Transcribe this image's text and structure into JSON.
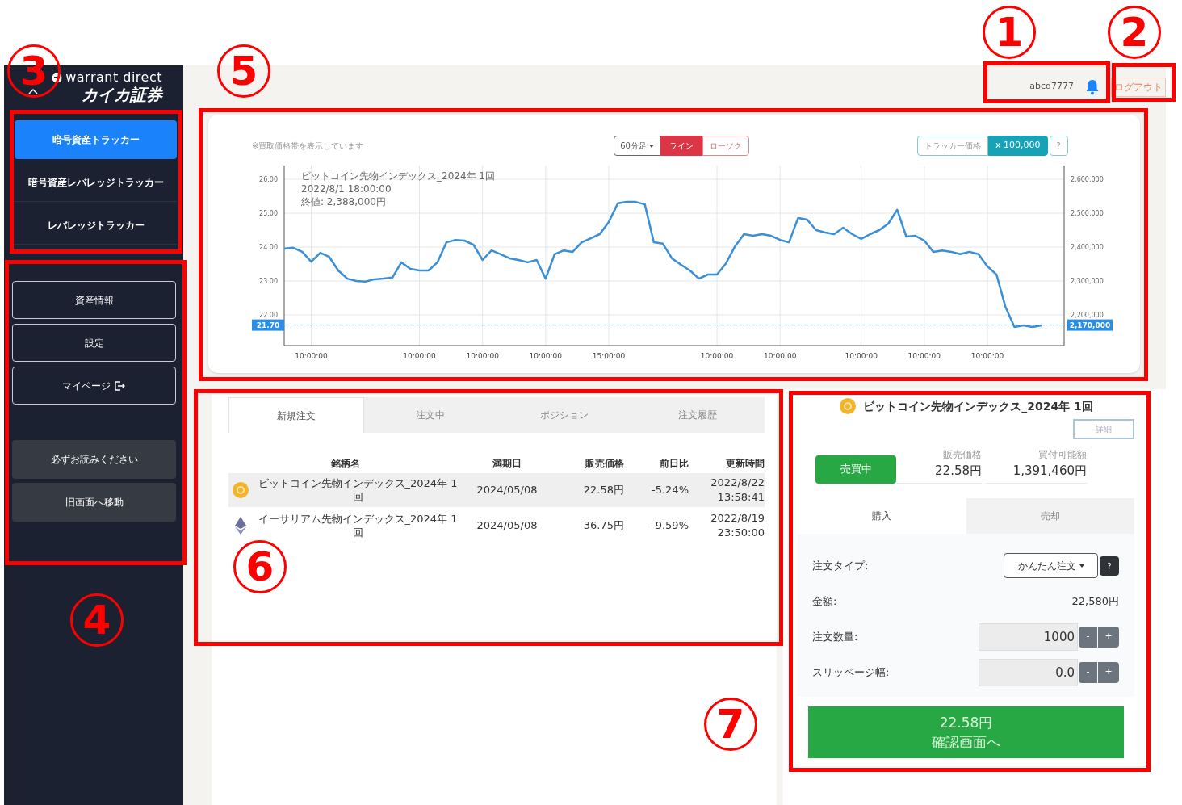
{
  "annotations": [
    {
      "label": "1"
    },
    {
      "label": "2"
    },
    {
      "label": "3"
    },
    {
      "label": "4"
    },
    {
      "label": "5"
    },
    {
      "label": "6"
    },
    {
      "label": "7"
    }
  ],
  "sidebar": {
    "brand": "warrant direct",
    "company": "カイカ証券",
    "tracker_menu": [
      {
        "label": "暗号資産トラッカー",
        "selected": true
      },
      {
        "label": "暗号資産レバレッジトラッカー",
        "selected": false
      },
      {
        "label": "レバレッジトラッカー",
        "selected": false
      }
    ],
    "menu_buttons": [
      {
        "label": "資産情報",
        "external": false
      },
      {
        "label": "設定",
        "external": false
      },
      {
        "label": "マイページ",
        "external": true
      }
    ],
    "info_buttons": [
      {
        "label": "必ずお読みください"
      },
      {
        "label": "旧画面へ移動"
      }
    ]
  },
  "header": {
    "user": "abcd7777",
    "logout": "ログアウト"
  },
  "chart_panel": {
    "note": "※買取価格帯を表示しています",
    "interval": "60分足",
    "chart_styles": [
      {
        "label": "ライン",
        "selected": true
      },
      {
        "label": "ローソク",
        "selected": false
      }
    ],
    "price_modes": [
      {
        "label": "トラッカー価格",
        "selected": false
      },
      {
        "label": "x 100,000",
        "selected": true
      }
    ],
    "help": "?",
    "tooltip": [
      "ビットコイン先物インデックス_2024年 1回",
      "2022/8/1 18:00:00",
      "終値: 2,388,000円"
    ],
    "x_axis_labels": [
      "10:00:00",
      "10:00:00",
      "10:00:00",
      "10:00:00",
      "15:00:00",
      "10:00:00",
      "10:00:00",
      "10:00:00",
      "10:00:00",
      "10:00:00"
    ],
    "right_axis_labels": [
      "2,600,000",
      "2,500,000",
      "2,400,000",
      "2,300,000",
      "2,200,000"
    ],
    "current_price_scaled": "2,170,000",
    "chart_data": {
      "type": "line",
      "ylim": [
        21.1,
        26.4
      ],
      "grid": true,
      "ref_lines": [
        {
          "axis": "y",
          "value": 21.7,
          "label": "21.70"
        }
      ],
      "yticks": [
        {
          "value": 22,
          "label": "22.00"
        },
        {
          "value": 23,
          "label": "23.00"
        },
        {
          "value": 24,
          "label": "24.00"
        },
        {
          "value": 25,
          "label": "25.00"
        },
        {
          "value": 26,
          "label": "26.00"
        }
      ],
      "series": [
        {
          "color": "#3a8fd6",
          "values": [
            23.95,
            23.98,
            23.86,
            23.57,
            23.83,
            23.71,
            23.31,
            23.07,
            23.0,
            22.98,
            23.05,
            23.07,
            23.1,
            23.55,
            23.36,
            23.31,
            23.31,
            23.55,
            24.14,
            24.21,
            24.19,
            24.07,
            23.62,
            23.9,
            23.79,
            23.67,
            23.62,
            23.55,
            23.62,
            23.07,
            23.79,
            23.9,
            23.86,
            24.14,
            24.26,
            24.38,
            24.74,
            25.29,
            25.33,
            25.33,
            25.26,
            24.14,
            24.1,
            23.67,
            23.48,
            23.31,
            23.07,
            23.19,
            23.19,
            23.52,
            24.02,
            24.38,
            24.33,
            24.38,
            24.33,
            24.21,
            24.14,
            24.86,
            24.81,
            24.5,
            24.43,
            24.38,
            24.57,
            24.38,
            24.24,
            24.38,
            24.5,
            24.69,
            25.1,
            24.31,
            24.33,
            24.19,
            23.86,
            23.9,
            23.86,
            23.79,
            23.86,
            23.79,
            23.43,
            23.19,
            22.24,
            21.64,
            21.69,
            21.64,
            21.69
          ]
        }
      ]
    }
  },
  "orders": {
    "tabs": [
      {
        "label": "新規注文",
        "selected": true
      },
      {
        "label": "注文中",
        "selected": false
      },
      {
        "label": "ポジション",
        "selected": false
      },
      {
        "label": "注文履歴",
        "selected": false
      }
    ],
    "columns": [
      "銘柄名",
      "満期日",
      "販売価格",
      "前日比",
      "更新時間"
    ],
    "rows": [
      {
        "kind": "bitcoin",
        "selected": true,
        "cells": [
          "ビットコイン先物インデックス_2024年 1回",
          "2024/05/08",
          "22.58円",
          "-5.24%",
          "2022/8/22 13:58:41"
        ]
      },
      {
        "kind": "ethereum",
        "selected": false,
        "cells": [
          "イーサリアム先物インデックス_2024年 1回",
          "2024/05/08",
          "36.75円",
          "-9.59%",
          "2022/8/19 23:50:00"
        ]
      }
    ]
  },
  "order_panel": {
    "title": "ビットコイン先物インデックス_2024年 1回",
    "detail_button": "詳細",
    "status": "売買中",
    "stats": [
      {
        "label": "販売価格",
        "value": "22.58円"
      },
      {
        "label": "買付可能額",
        "value": "1,391,460円"
      }
    ],
    "tabs": [
      {
        "label": "購入",
        "selected": true
      },
      {
        "label": "売却",
        "selected": false
      }
    ],
    "fields": [
      {
        "kind": "select",
        "label": "注文タイプ:",
        "value": "かんたん注文",
        "help": "?"
      },
      {
        "kind": "text",
        "label": "金額:",
        "value": "22,580円"
      },
      {
        "kind": "stepper",
        "label": "注文数量:",
        "value": "1000",
        "minus": "-",
        "plus": "+"
      },
      {
        "kind": "stepper",
        "label": "スリッページ幅:",
        "value": "0.0",
        "minus": "-",
        "plus": "+"
      }
    ],
    "confirm": {
      "price": "22.58円",
      "label": "確認画面へ"
    }
  }
}
